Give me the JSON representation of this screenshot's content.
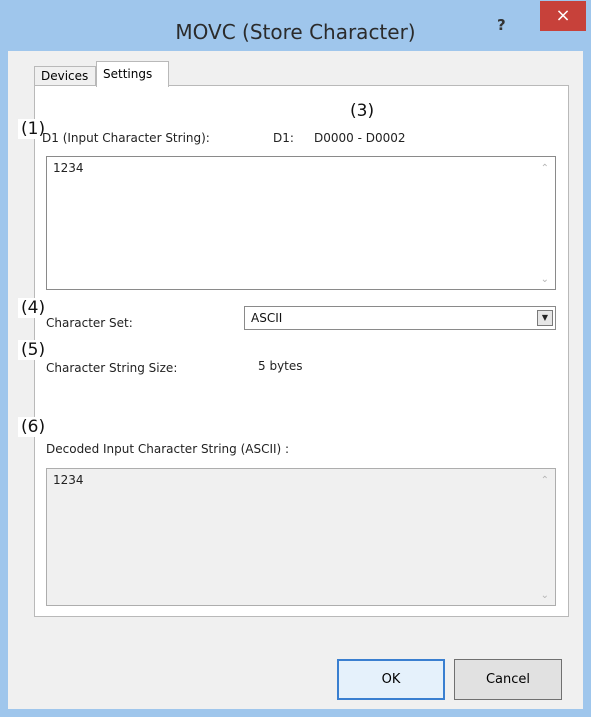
{
  "window": {
    "title": "MOVC  (Store Character)",
    "help_label": "?",
    "close_label": "×"
  },
  "tabs": [
    {
      "label": "Devices"
    },
    {
      "label": "Settings"
    }
  ],
  "annotations": [
    "(1)",
    "(3)",
    "(4)",
    "(5)",
    "(6)"
  ],
  "input_string": {
    "label": "D1 (Input Character String):",
    "device_prefix": "D1:",
    "device_range": "D0000 - D0002",
    "value": "1234"
  },
  "character_set": {
    "label": "Character Set:",
    "selected": "ASCII"
  },
  "string_size": {
    "label": "Character String Size:",
    "value": "5 bytes"
  },
  "decoded": {
    "label": "Decoded Input Character String (ASCII) :",
    "value": "1234"
  },
  "buttons": {
    "ok": "OK",
    "cancel": "Cancel"
  },
  "colors": {
    "frame": "#9fc6ec",
    "close": "#c7413a",
    "panel_bg": "#f0f0f0"
  }
}
